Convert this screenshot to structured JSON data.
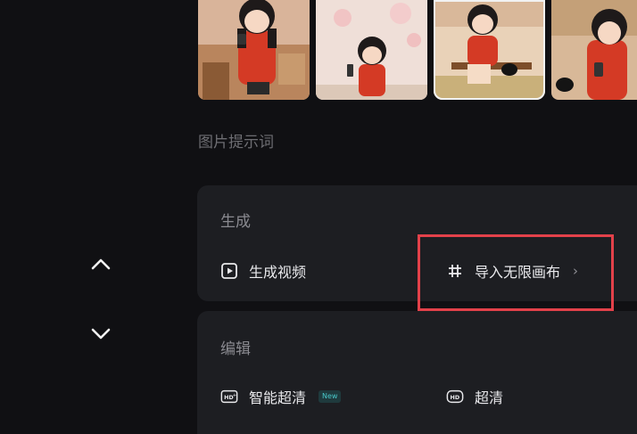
{
  "prompt_section": {
    "heading": "图片提示词"
  },
  "generate_card": {
    "title": "生成",
    "generate_video": {
      "label": "生成视频",
      "icon": "play-icon"
    },
    "import_canvas": {
      "label": "导入无限画布",
      "icon": "crop-icon"
    }
  },
  "edit_card": {
    "title": "编辑",
    "smart_hd": {
      "label": "智能超清",
      "badge": "New",
      "icon": "hd-plus-icon"
    },
    "hd": {
      "label": "超清",
      "icon": "hd-icon"
    }
  },
  "colors": {
    "highlight": "#e3414a",
    "background": "#101013",
    "card": "#1d1e22",
    "new_badge": "#49c7c9"
  }
}
